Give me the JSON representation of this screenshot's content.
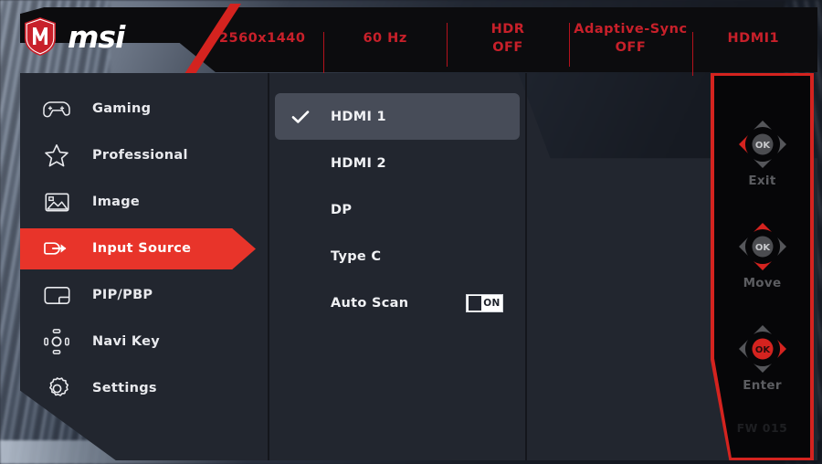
{
  "brand": {
    "name": "msi",
    "logo_icon": "msi-dragon-shield-icon",
    "accent_red": "#e8342a",
    "status_red": "#c8202a",
    "panel_bg": "#22262f",
    "header_bg": "#0c0c0e",
    "selected_bg": "#474c58"
  },
  "status_bar": {
    "items": [
      {
        "primary": "2560x1440",
        "secondary": ""
      },
      {
        "primary": "60 Hz",
        "secondary": ""
      },
      {
        "primary": "HDR",
        "secondary": "OFF"
      },
      {
        "primary": "Adaptive-Sync",
        "secondary": "OFF"
      },
      {
        "primary": "HDMI1",
        "secondary": ""
      }
    ]
  },
  "sidebar": {
    "items": [
      {
        "label": "Gaming",
        "icon": "gamepad-icon",
        "active": false
      },
      {
        "label": "Professional",
        "icon": "star-icon",
        "active": false
      },
      {
        "label": "Image",
        "icon": "picture-icon",
        "active": false
      },
      {
        "label": "Input Source",
        "icon": "input-arrow-icon",
        "active": true
      },
      {
        "label": "PIP/PBP",
        "icon": "pip-pbp-icon",
        "active": false
      },
      {
        "label": "Navi Key",
        "icon": "navi-key-icon",
        "active": false
      },
      {
        "label": "Settings",
        "icon": "gear-icon",
        "active": false
      }
    ]
  },
  "options": {
    "title": "Input Source",
    "items": [
      {
        "label": "HDMI 1",
        "selected": true,
        "checked": true,
        "control": "none"
      },
      {
        "label": "HDMI 2",
        "selected": false,
        "checked": false,
        "control": "none"
      },
      {
        "label": "DP",
        "selected": false,
        "checked": false,
        "control": "none"
      },
      {
        "label": "Type C",
        "selected": false,
        "checked": false,
        "control": "none"
      },
      {
        "label": "Auto Scan",
        "selected": false,
        "checked": false,
        "control": "toggle",
        "toggle_value": "ON"
      }
    ]
  },
  "nav_hints": {
    "items": [
      {
        "label": "Exit",
        "icon": "dpad-left-icon",
        "highlight": "left"
      },
      {
        "label": "Move",
        "icon": "dpad-updown-icon",
        "highlight": "updown"
      },
      {
        "label": "Enter",
        "icon": "dpad-ok-right-icon",
        "highlight": "center-right"
      }
    ],
    "firmware": "FW 015"
  }
}
